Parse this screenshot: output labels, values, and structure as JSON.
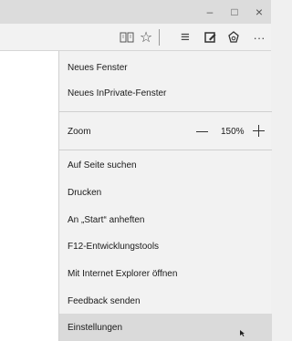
{
  "window": {
    "minimize_icon": "minimize-icon",
    "maximize_icon": "maximize-icon",
    "close_icon": "close-icon",
    "minimize_glyph": "–",
    "maximize_glyph": "□",
    "close_glyph": "×"
  },
  "toolbar": {
    "reading_view_icon": "book-icon",
    "favorites_icon": "star-icon",
    "hub_icon": "hub-icon",
    "web_note_icon": "pen-icon",
    "share_icon": "share-icon",
    "more_icon": "more-icon",
    "star_glyph": "☆",
    "hub_glyph": "≡",
    "more_glyph": "···"
  },
  "menu": {
    "new_window": "Neues Fenster",
    "new_private_window": "Neues InPrivate-Fenster",
    "zoom_label": "Zoom",
    "zoom_value": "150%",
    "find_on_page": "Auf Seite suchen",
    "print": "Drucken",
    "pin_to_start": "An „Start“ anheften",
    "f12_tools": "F12-Entwicklungstools",
    "open_with_ie": "Mit Internet Explorer öffnen",
    "send_feedback": "Feedback senden",
    "settings": "Einstellungen"
  }
}
